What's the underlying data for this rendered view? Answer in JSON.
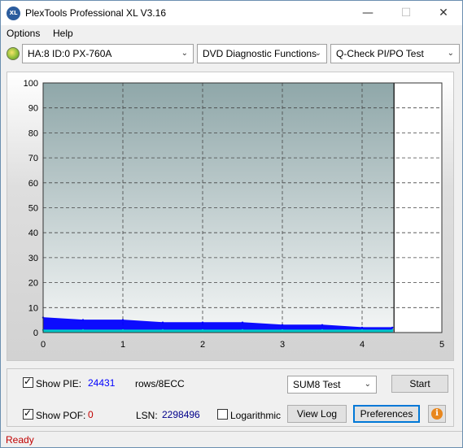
{
  "window": {
    "title": "PlexTools Professional XL V3.16",
    "app_icon_text": "XL"
  },
  "controls_glyphs": {
    "minimize": "—",
    "maximize": "☐",
    "close": "✕"
  },
  "menu": {
    "options": "Options",
    "help": "Help"
  },
  "toolbar": {
    "drive": "HA:8 ID:0  PX-760A",
    "function": "DVD Diagnostic Functions",
    "test": "Q-Check PI/PO Test"
  },
  "chart_data": {
    "type": "area",
    "x_ticks": [
      "0",
      "1",
      "2",
      "3",
      "4",
      "5"
    ],
    "y_ticks": [
      "0",
      "10",
      "20",
      "30",
      "40",
      "50",
      "60",
      "70",
      "80",
      "90",
      "100"
    ],
    "xlim": [
      0,
      5
    ],
    "ylim": [
      0,
      100
    ],
    "grid": true,
    "scan_end_x": 4.4,
    "series": [
      {
        "color": "#0000ff",
        "x": [
          0,
          0.5,
          1.0,
          1.5,
          2.0,
          2.5,
          3.0,
          3.5,
          4.0,
          4.38
        ],
        "y": [
          6,
          5,
          5,
          4,
          4,
          4,
          3,
          3,
          2,
          2
        ]
      },
      {
        "color": "#00c8c8",
        "x": [
          0,
          0.5,
          1.0,
          1.5,
          2.0,
          2.5,
          3.0,
          3.5,
          4.0,
          4.38
        ],
        "y": [
          1,
          1,
          1,
          1,
          1,
          1,
          1,
          1,
          1,
          1
        ]
      }
    ]
  },
  "bottom": {
    "show_pie_label": "Show PIE:",
    "pie_value": "24431",
    "rows_label": "rows/8ECC",
    "show_pof_label": "Show POF:",
    "pof_value": "0",
    "lsn_label": "LSN:",
    "lsn_value": "2298496",
    "logarithmic_label": "Logarithmic",
    "sum8_select": "SUM8 Test",
    "start_button": "Start",
    "view_log_button": "View Log",
    "preferences_button": "Preferences",
    "info_glyph": "i"
  },
  "status": {
    "text": "Ready"
  },
  "colors": {
    "accent": "#0078d7",
    "pie": "#0000ff",
    "pof": "#c00000",
    "status": "#c00000"
  }
}
